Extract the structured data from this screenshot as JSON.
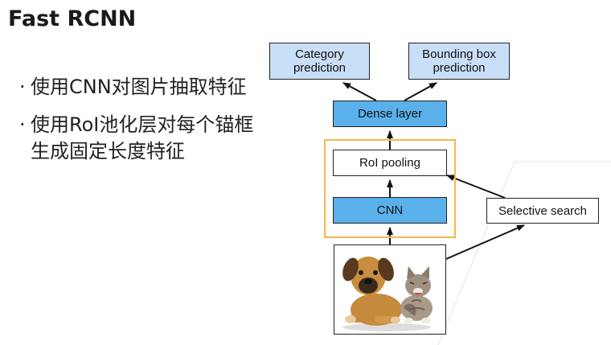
{
  "title": "Fast RCNN",
  "bullets": [
    {
      "text": "使用CNN对图片抽取特征"
    },
    {
      "text": "使用RoI池化层对每个锚框生成固定长度特征"
    }
  ],
  "diagram": {
    "category_prediction": "Category prediction",
    "bbox_prediction": "Bounding box prediction",
    "dense_layer": "Dense layer",
    "roi_pooling": "RoI pooling",
    "cnn": "CNN",
    "selective_search": "Selective search"
  },
  "colors": {
    "light_box": "#c9def7",
    "blue_box": "#5ab0ea",
    "frame": "#f5b84d"
  },
  "image": {
    "icon": "puppy-and-kitten-photo"
  }
}
